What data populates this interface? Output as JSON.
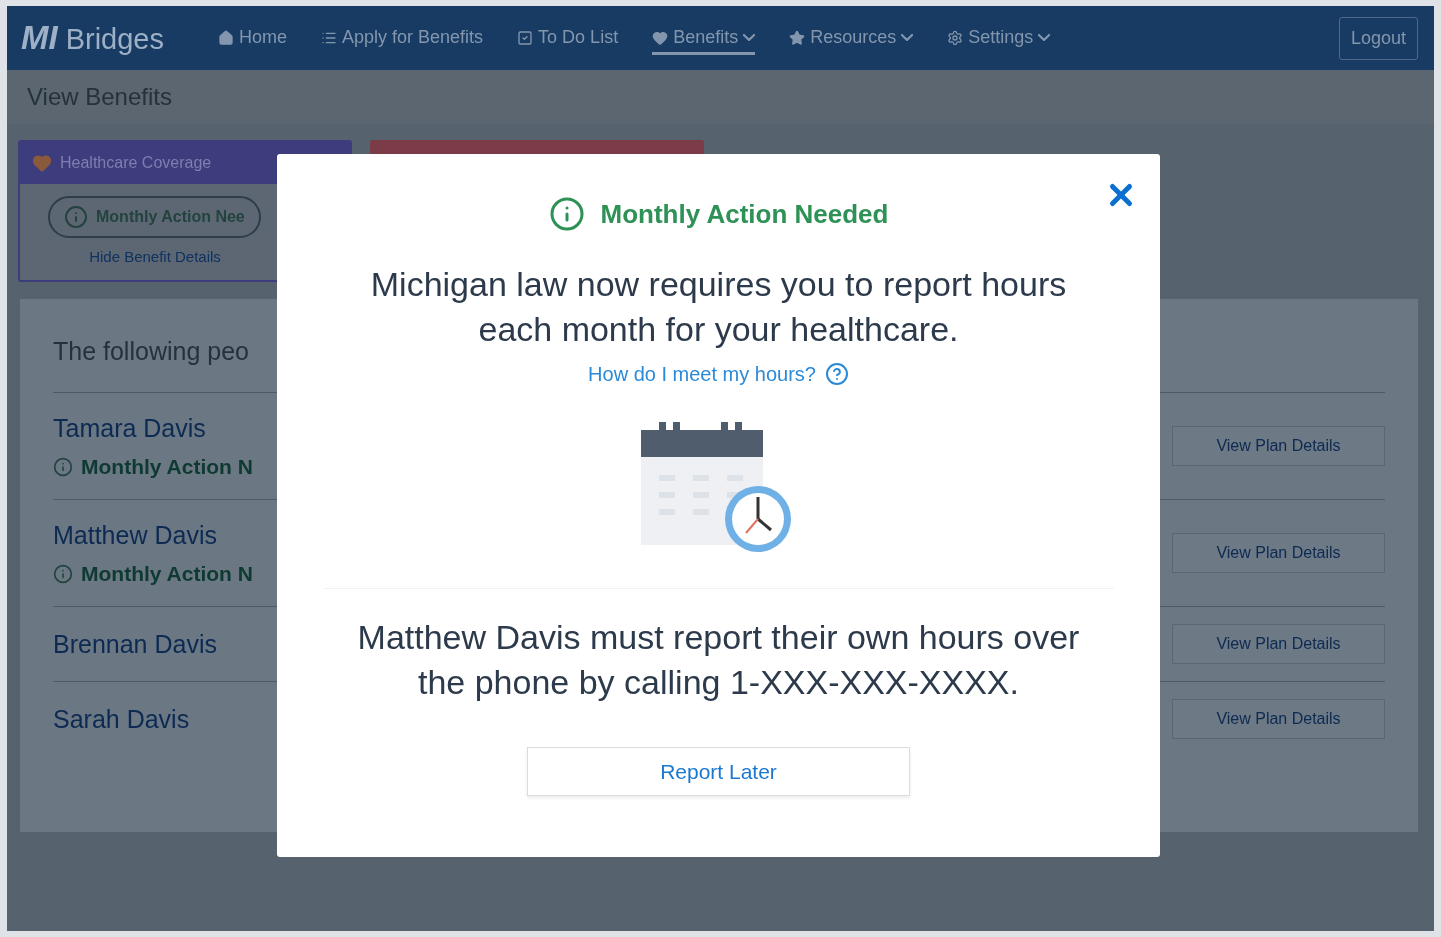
{
  "app": {
    "logo": {
      "mark": "MI",
      "name": "Bridges"
    },
    "nav": [
      {
        "label": "Home",
        "dropdown": false,
        "selected": false
      },
      {
        "label": "Apply for Benefits",
        "dropdown": false,
        "selected": false
      },
      {
        "label": "To Do List",
        "dropdown": false,
        "selected": false
      },
      {
        "label": "Benefits",
        "dropdown": true,
        "selected": true
      },
      {
        "label": "Resources",
        "dropdown": true,
        "selected": false
      },
      {
        "label": "Settings",
        "dropdown": true,
        "selected": false
      }
    ],
    "logout": "Logout"
  },
  "page_title": "View Benefits",
  "benefit_cards": [
    {
      "title": "Healthcare Coverage",
      "color": "#3d3c7c",
      "status": "Monthly Action Nee",
      "toggle": "Hide Benefit Details"
    },
    {
      "color": "#7b3c48"
    }
  ],
  "people": {
    "intro": "The following peo",
    "rows": [
      {
        "name": "Tamara Davis",
        "status": "Monthly Action N",
        "button": "View Plan Details"
      },
      {
        "name": "Matthew Davis",
        "status": "Monthly Action N",
        "button": "View Plan Details"
      },
      {
        "name": "Brennan Davis",
        "button": "View Plan Details"
      },
      {
        "name": "Sarah Davis",
        "button": "View Plan Details"
      }
    ]
  },
  "modal": {
    "title": "Monthly Action Needed",
    "message": "Michigan law now requires you to report hours each month for your healthcare.",
    "link": "How do I meet my hours?",
    "detail": "Matthew Davis must report their own hours over the phone by calling 1-XXX-XXX-XXXX.",
    "button": "Report Later"
  }
}
